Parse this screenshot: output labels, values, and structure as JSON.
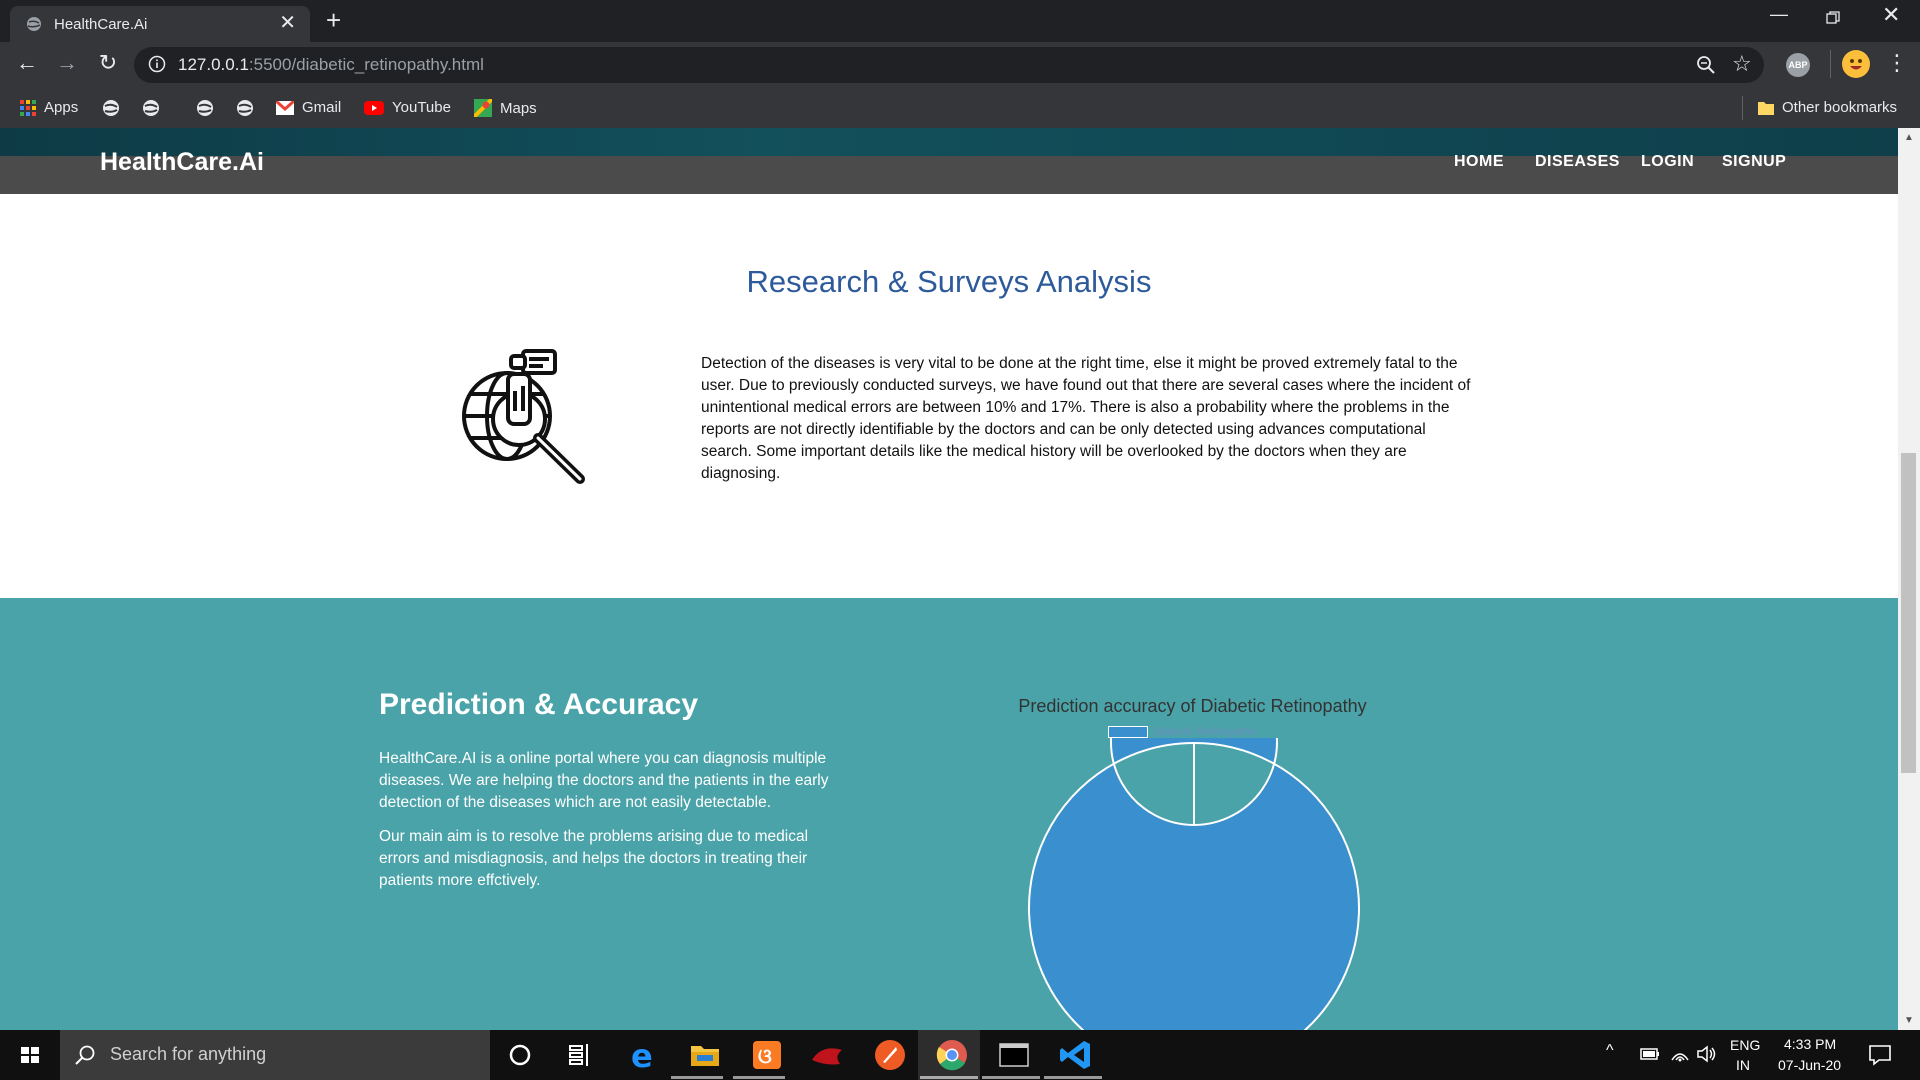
{
  "browser": {
    "tab_title": "HealthCare.Ai",
    "url_host": "127.0.0.1",
    "url_path": ":5500/diabetic_retinopathy.html",
    "bookmarks": {
      "apps": "Apps",
      "gmail": "Gmail",
      "youtube": "YouTube",
      "maps": "Maps",
      "other": "Other bookmarks"
    },
    "extension_badge": "ABP"
  },
  "site": {
    "brand": "HealthCare.Ai",
    "nav": [
      "HOME",
      "DISEASES",
      "LOGIN",
      "SIGNUP"
    ]
  },
  "research": {
    "title": "Research & Surveys Analysis",
    "body": "Detection of the diseases is very vital to be done at the right time, else it might be proved extremely fatal to the user. Due to previously conducted surveys, we have found out that there are several cases where the incident of unintentional medical errors are between 10% and 17%. There is also a probability where the problems in the reports are not directly identifiable by the doctors and can be only detected using advances computational search. Some important details like the medical history will be overlooked by the doctors when they are diagnosing."
  },
  "prediction": {
    "title": "Prediction & Accuracy",
    "para1": "HealthCare.AI is a online portal where you can diagnosis multiple diseases. We are helping the doctors and the patients in the early detection of the diseases which are not easily detectable.",
    "para2": "Our main aim is to resolve the problems arising due to medical errors and misdiagnosis, and helps the doctors in treating their patients more effctively."
  },
  "chart_data": {
    "type": "pie",
    "title": "Prediction accuracy of Diabetic Retinopathy",
    "series": [
      {
        "name": "Diabetic Retinopathy",
        "values": [
          100
        ]
      }
    ],
    "colors": [
      "#3a8fcf"
    ],
    "legend_position": "top"
  },
  "taskbar": {
    "search_placeholder": "Search for anything",
    "lang_top": "ENG",
    "lang_bottom": "IN",
    "time": "4:33 PM",
    "date": "07-Jun-20"
  },
  "colors": {
    "teal": "#4aa3a8",
    "nav": "#4b4b4b",
    "title_blue": "#2d5a9a",
    "chart_blue": "#3a8fcf"
  }
}
